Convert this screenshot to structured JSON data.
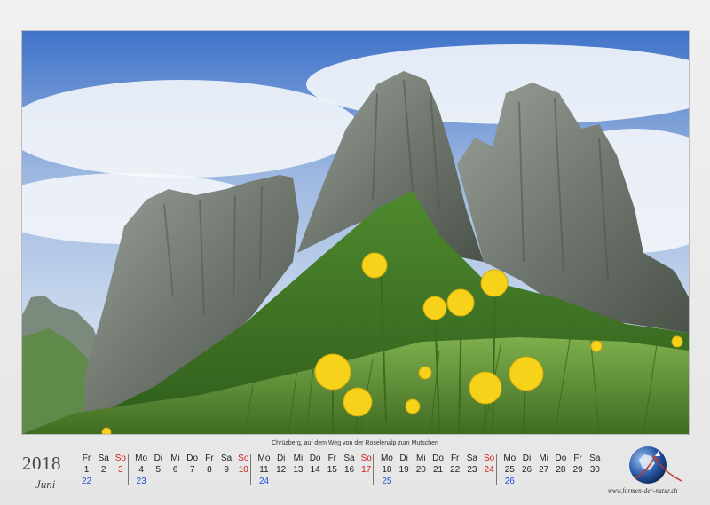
{
  "photo": {
    "caption": "Chrüzberg, auf dem Weg von der Roselenalp zum Mutschen"
  },
  "calendar": {
    "year": "2018",
    "month": "Juni",
    "weeks": [
      {
        "number": "22",
        "days": [
          {
            "h": "Fr",
            "d": "1"
          },
          {
            "h": "Sa",
            "d": "2"
          },
          {
            "h": "So",
            "d": "3",
            "sun": true
          }
        ]
      },
      {
        "number": "23",
        "days": [
          {
            "h": "Mo",
            "d": "4"
          },
          {
            "h": "Di",
            "d": "5"
          },
          {
            "h": "Mi",
            "d": "6"
          },
          {
            "h": "Do",
            "d": "7"
          },
          {
            "h": "Fr",
            "d": "8"
          },
          {
            "h": "Sa",
            "d": "9"
          },
          {
            "h": "So",
            "d": "10",
            "sun": true
          }
        ]
      },
      {
        "number": "24",
        "days": [
          {
            "h": "Mo",
            "d": "11"
          },
          {
            "h": "Di",
            "d": "12"
          },
          {
            "h": "Mi",
            "d": "13"
          },
          {
            "h": "Do",
            "d": "14"
          },
          {
            "h": "Fr",
            "d": "15"
          },
          {
            "h": "Sa",
            "d": "16"
          },
          {
            "h": "So",
            "d": "17",
            "sun": true
          }
        ]
      },
      {
        "number": "25",
        "days": [
          {
            "h": "Mo",
            "d": "18"
          },
          {
            "h": "Di",
            "d": "19"
          },
          {
            "h": "Mi",
            "d": "20"
          },
          {
            "h": "Do",
            "d": "21"
          },
          {
            "h": "Fr",
            "d": "22"
          },
          {
            "h": "Sa",
            "d": "23"
          },
          {
            "h": "So",
            "d": "24",
            "sun": true
          }
        ]
      },
      {
        "number": "26",
        "days": [
          {
            "h": "Mo",
            "d": "25"
          },
          {
            "h": "Di",
            "d": "26"
          },
          {
            "h": "Mi",
            "d": "27"
          },
          {
            "h": "Do",
            "d": "28"
          },
          {
            "h": "Fr",
            "d": "29"
          },
          {
            "h": "Sa",
            "d": "30"
          }
        ]
      }
    ]
  },
  "brand": {
    "url": "www.formen-der-natur.ch"
  },
  "colors": {
    "sunday": "#d21a1a",
    "week_number": "#1f4fd6"
  }
}
